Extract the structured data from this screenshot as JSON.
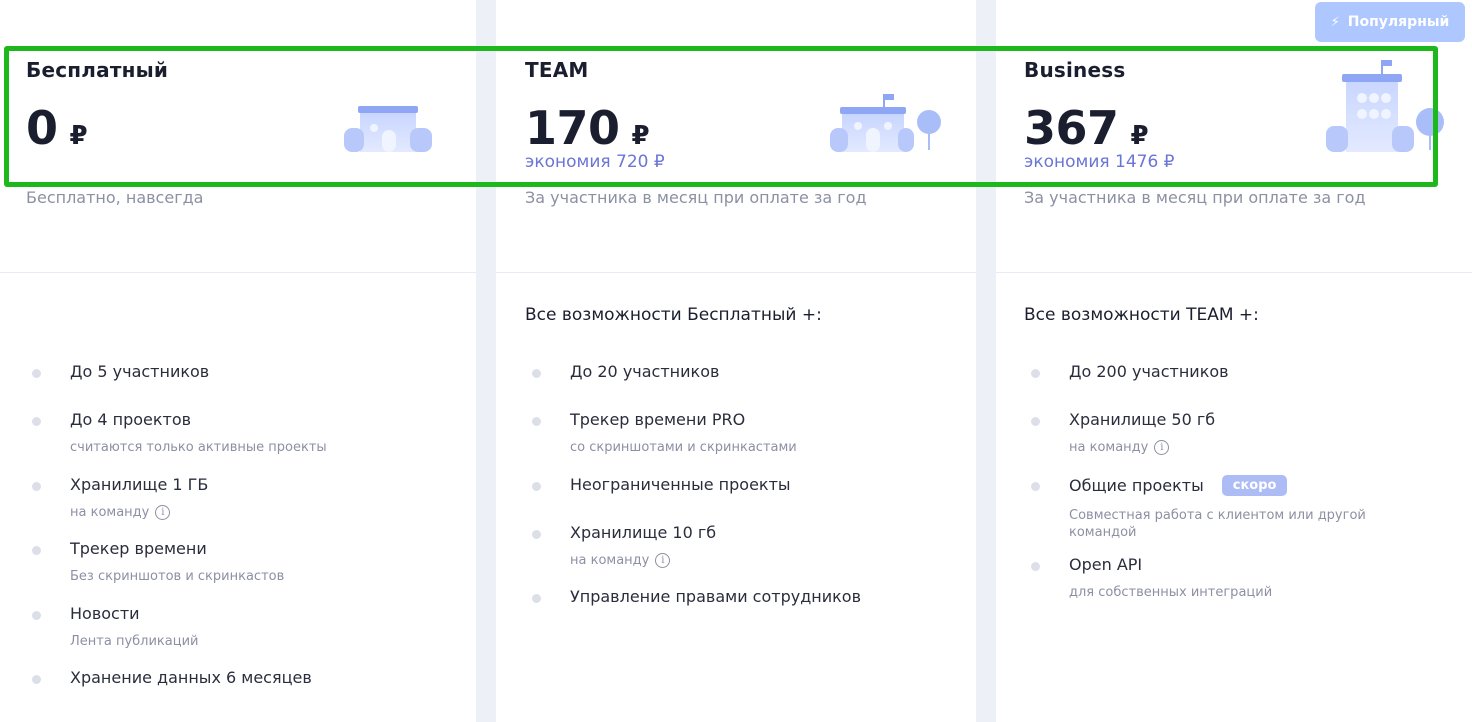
{
  "popular_badge": {
    "label": "Популярный",
    "icon": "bolt-icon"
  },
  "plans": [
    {
      "name": "Бесплатный",
      "price": "0",
      "currency": "₽",
      "price_note": "Бесплатно, навсегда",
      "features": [
        {
          "title": "До 5 участников"
        },
        {
          "title": "До 4 проектов",
          "sub": "считаются только активные проекты"
        },
        {
          "title": "Хранилище 1 ГБ",
          "sub": "на команду"
        },
        {
          "title": "Трекер времени",
          "sub": "Без скриншотов и скринкастов"
        },
        {
          "title": "Новости",
          "sub": "Лента публикаций"
        },
        {
          "title": "Хранение данных 6 месяцев"
        }
      ]
    },
    {
      "name": "TEAM",
      "price": "170",
      "currency": "₽",
      "savings": "экономия 720 ₽",
      "price_note": "За участника в месяц при оплате за год",
      "all_features": "Все возможности Бесплатный +:",
      "features": [
        {
          "title": "До 20 участников"
        },
        {
          "title": "Трекер времени PRO",
          "sub": "со скриншотами и скринкастами"
        },
        {
          "title": "Неограниченные проекты"
        },
        {
          "title": "Хранилище 10 гб",
          "sub": "на команду"
        },
        {
          "title": "Управление правами сотрудников"
        }
      ]
    },
    {
      "name": "Business",
      "price": "367",
      "currency": "₽",
      "savings": "экономия 1476 ₽",
      "price_note": "За участника в месяц при оплате за год",
      "all_features": "Все возможности TEAM +:",
      "features": [
        {
          "title": "До 200 участников"
        },
        {
          "title": "Хранилище 50 гб",
          "sub": "на команду"
        },
        {
          "title": "Общие проекты",
          "badge": "скоро",
          "sub": "Совместная работа с клиентом или другой командой"
        },
        {
          "title": "Open API",
          "sub": "для собственных интеграций"
        }
      ]
    }
  ],
  "colors": {
    "accent": "#6a75d6",
    "highlight": "#1cb81c",
    "badge": "#aec7ff",
    "soon_badge": "#aebcf5"
  }
}
